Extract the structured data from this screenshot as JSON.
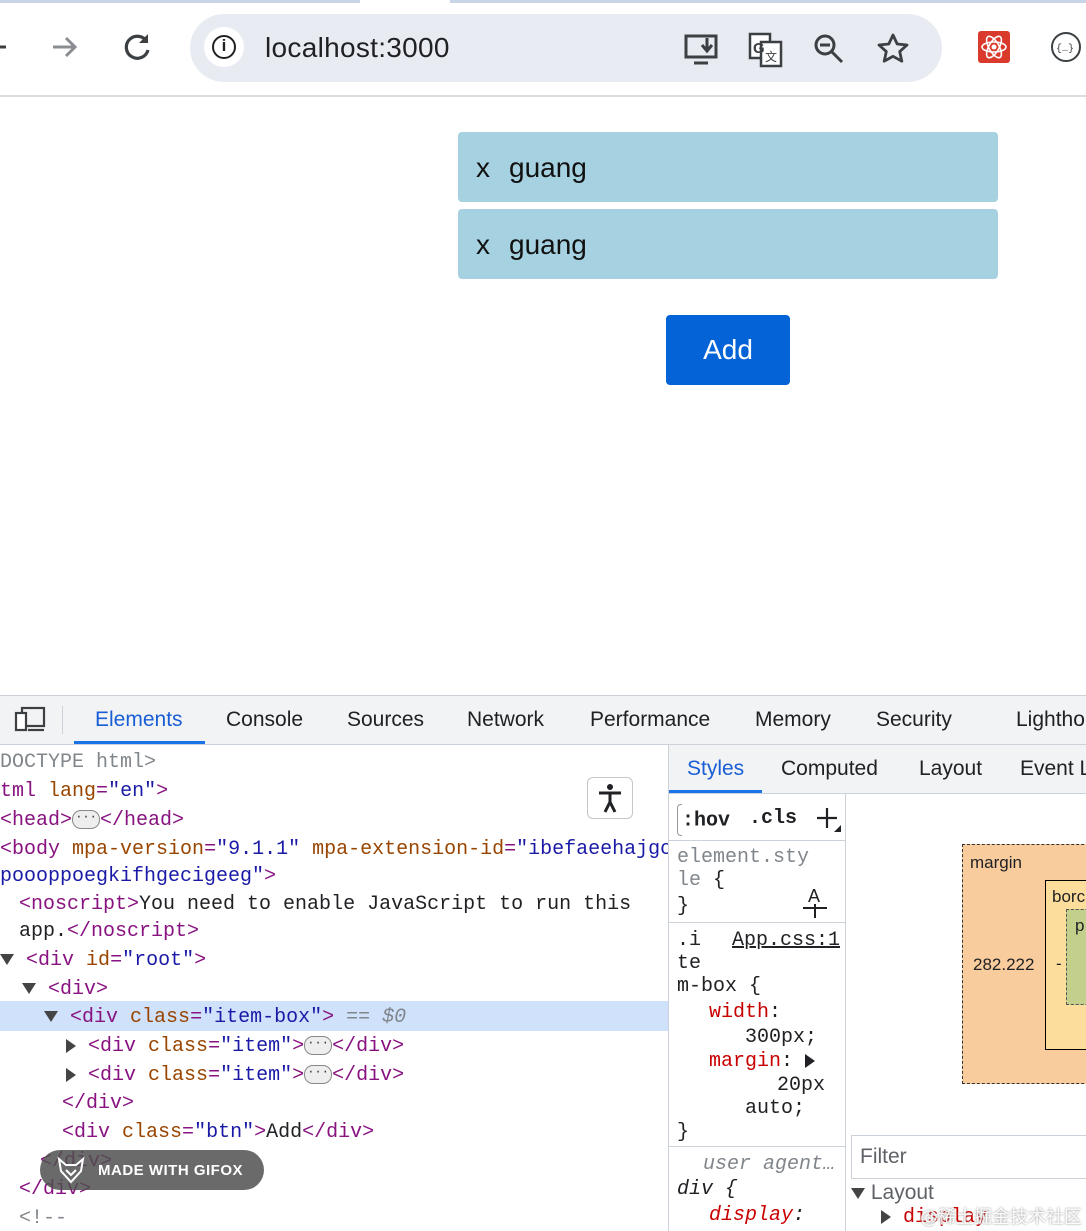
{
  "browser": {
    "url": "localhost:3000",
    "icons": [
      "back-arrow-icon",
      "forward-arrow-icon",
      "reload-icon",
      "info-icon",
      "install-app-icon",
      "translate-icon",
      "zoom-icon",
      "bookmark-star-icon",
      "react-devtools-icon",
      "json-viewer-icon"
    ]
  },
  "page": {
    "items": [
      {
        "remove": "x",
        "name": "guang"
      },
      {
        "remove": "x",
        "name": "guang"
      }
    ],
    "add_label": "Add",
    "colors": {
      "item_bg": "#a6d1e0",
      "button_bg": "#0563d8"
    }
  },
  "devtools": {
    "tabs": [
      "Elements",
      "Console",
      "Sources",
      "Network",
      "Performance",
      "Memory",
      "Security",
      "Lightho"
    ],
    "dom": {
      "doctype": "DOCTYPE html>",
      "html_open_tag": "tml",
      "html_lang_attr": "lang",
      "html_lang_val": "\"en\"",
      "head_open": "<head>",
      "head_close": "</head>",
      "body_tag": "<body",
      "body_attr1": "mpa-version",
      "body_val1": "\"9.1.1\"",
      "body_attr2": "mpa-extension-id",
      "body_val2_a": "\"ibefaeehajgc",
      "body_val2_b": "poooppoegkifhgecigeeg\"",
      "noscript_open": "<noscript>",
      "noscript_text_a": "You need to enable JavaScript to run this",
      "noscript_text_b": "app.",
      "noscript_close": "</noscript>",
      "div_root_tag": "<div",
      "div_root_attr": "id",
      "div_root_val": "\"root\"",
      "div_open": "<div>",
      "itembox_tag": "<div",
      "itembox_attr": "class",
      "itembox_val": "\"item-box\"",
      "selected_marker": "== $0",
      "item_tag": "<div",
      "item_attr": "class",
      "item_val": "\"item\"",
      "div_close": "</div>",
      "btn_tag": "<div",
      "btn_attr": "class",
      "btn_val": "\"btn\"",
      "btn_text": "Add",
      "outer_div_close": "</div>",
      "comment_start": "<!--"
    },
    "styles_tabs": [
      "Styles",
      "Computed",
      "Layout",
      "Event L"
    ],
    "styles": {
      "hov": ":hov",
      "cls": ".cls",
      "element_style_a": "element.sty",
      "element_style_b": "le",
      "brace_open": "{",
      "brace_close": "}",
      "selector_a": ".i",
      "source": "App.css:1",
      "selector_b": "te",
      "selector_c": "m-box",
      "prop_width": "width",
      "val_width": "300px;",
      "prop_margin": "margin",
      "val_margin_a": "20px",
      "val_margin_b": "auto;",
      "user_agent": "user agent…",
      "ua_selector": "div",
      "ua_prop": "display",
      "colon": ":"
    },
    "boxmodel": {
      "margin_label": "margin",
      "border_label": "borc",
      "padding_label": "p",
      "margin_left": "282.222",
      "dash": "-"
    },
    "filter_placeholder": "Filter",
    "computed_layout": "Layout",
    "computed_display": "display"
  },
  "overlays": {
    "gifox": "MADE WITH GIFOX",
    "watermark": "@稀土掘金技术社区"
  }
}
